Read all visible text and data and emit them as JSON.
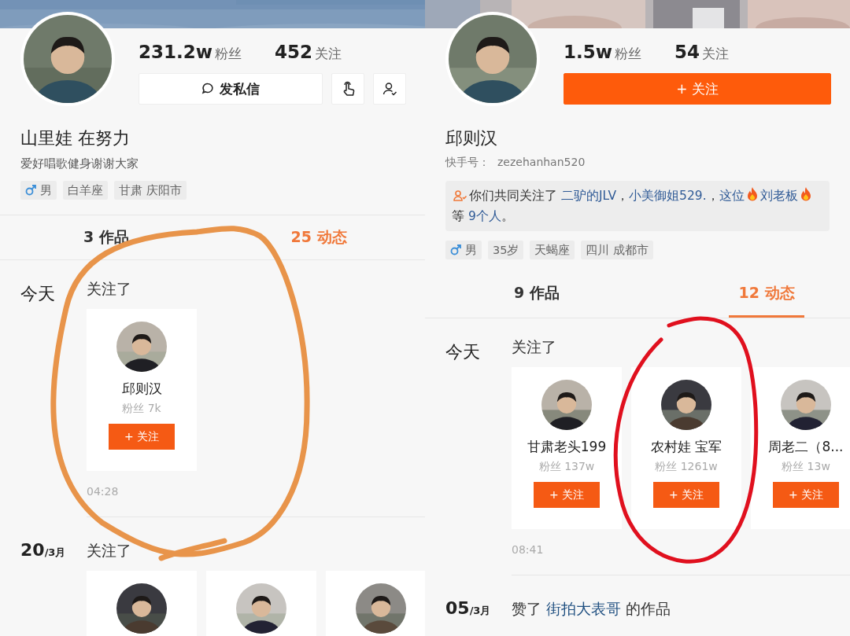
{
  "panels": [
    {
      "banner": {
        "kind": "sky"
      },
      "avatar": {
        "kind": "picture"
      },
      "stats": [
        {
          "value": "231.2w",
          "label": "粉丝"
        },
        {
          "value": "452",
          "label": "关注"
        }
      ],
      "actions": [
        {
          "kind": "message",
          "label": "发私信"
        },
        {
          "kind": "hand"
        },
        {
          "kind": "user-check"
        }
      ],
      "name": "山里娃 在努力",
      "bio": "爱好唱歌健身谢谢大家",
      "tags": [
        {
          "kind": "gender",
          "label": "男"
        },
        {
          "kind": "plain",
          "label": "白羊座"
        },
        {
          "kind": "plain",
          "label": "甘肃 庆阳市"
        }
      ],
      "tabs": [
        {
          "count": "3",
          "label": "作品",
          "selected": false,
          "underlined": false
        },
        {
          "count": "25",
          "label": "动态",
          "selected": true,
          "underlined": false
        }
      ],
      "feed": [
        {
          "kind": "follow",
          "day": "今天",
          "verb": "关注了",
          "users": [
            {
              "avatar": {
                "kind": "picture"
              },
              "name": "邱则汉",
              "fans": "粉丝 7k",
              "button": "+ 关注"
            }
          ],
          "time": "04:28"
        },
        {
          "kind": "follow",
          "day": "20",
          "month": "/3月",
          "verb": "关注了",
          "users": [
            {
              "avatar": {
                "kind": "picture"
              }
            },
            {
              "avatar": {
                "kind": "picture"
              }
            },
            {
              "avatar": {
                "kind": "picture"
              }
            }
          ]
        }
      ],
      "annotation": {
        "kind": "loop",
        "color": "#e8944a"
      }
    },
    {
      "banner": {
        "kind": "picture"
      },
      "avatar": {
        "kind": "picture"
      },
      "stats": [
        {
          "value": "1.5w",
          "label": "粉丝"
        },
        {
          "value": "54",
          "label": "关注"
        }
      ],
      "actions": [
        {
          "kind": "follow",
          "label": "+ 关注"
        }
      ],
      "name": "邱则汉",
      "id_label": "快手号：",
      "id_value": "zezehanhan520",
      "mutual": [
        {
          "kind": "text",
          "text": "你们共同关注了 "
        },
        {
          "kind": "link",
          "text": "二驴的JLV"
        },
        {
          "kind": "text",
          "text": "，"
        },
        {
          "kind": "link",
          "text": "小美御姐529."
        },
        {
          "kind": "text",
          "text": "，"
        },
        {
          "kind": "link",
          "text": "这位"
        },
        {
          "kind": "fire"
        },
        {
          "kind": "link",
          "text": "刘老板"
        },
        {
          "kind": "fire"
        },
        {
          "kind": "text",
          "text": " 等 "
        },
        {
          "kind": "link",
          "text": "9个人"
        },
        {
          "kind": "text",
          "text": "。"
        }
      ],
      "tags": [
        {
          "kind": "gender",
          "label": "男"
        },
        {
          "kind": "plain",
          "label": "35岁"
        },
        {
          "kind": "plain",
          "label": "天蝎座"
        },
        {
          "kind": "plain",
          "label": "四川 成都市"
        }
      ],
      "tabs": [
        {
          "count": "9",
          "label": "作品",
          "selected": false,
          "underlined": false
        },
        {
          "count": "12",
          "label": "动态",
          "selected": true,
          "underlined": true
        }
      ],
      "feed": [
        {
          "kind": "follow",
          "day": "今天",
          "verb": "关注了",
          "users": [
            {
              "avatar": {
                "kind": "picture"
              },
              "name": "甘肃老头199",
              "fans": "粉丝 137w",
              "button": "+ 关注"
            },
            {
              "avatar": {
                "kind": "picture"
              },
              "name": "农村娃  宝军",
              "fans": "粉丝 1261w",
              "button": "+ 关注"
            },
            {
              "avatar": {
                "kind": "picture"
              },
              "name": "周老二（8...",
              "fans": "粉丝 13w",
              "button": "+ 关注"
            }
          ],
          "time": "08:41"
        },
        {
          "kind": "like",
          "day": "05",
          "month": "/3月",
          "verb": "赞了",
          "target": "街拍大表哥",
          "suffix": "的作品"
        }
      ],
      "annotation": {
        "kind": "ellipse",
        "color": "#e0101e"
      }
    }
  ]
}
